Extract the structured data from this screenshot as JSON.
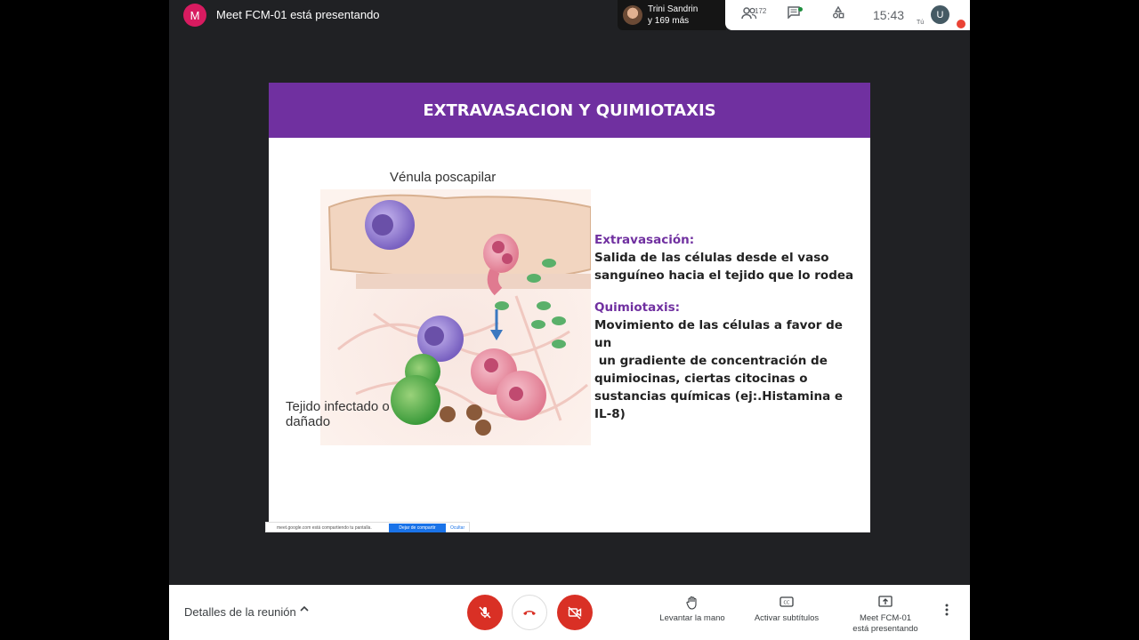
{
  "topbar": {
    "presenter_initial": "M",
    "presenting_title": "Meet FCM-01 está presentando",
    "participants_chip": {
      "line1": "Trini Sandrin",
      "line2": "y 169 más"
    },
    "participants_count": "172",
    "clock": "15:43",
    "user_initial": "U",
    "you_label": "Tú"
  },
  "slide": {
    "title": "EXTRAVASACION Y QUIMIOTAXIS",
    "figure_labels": {
      "venule": "Vénula poscapilar",
      "tissue": "Tejido infectado o dañado"
    },
    "extravasation": {
      "heading": "Extravasación:",
      "text": "Salida de las células desde el vaso sanguíneo hacia el tejido que lo rodea"
    },
    "chemotaxis": {
      "heading": "Quimiotaxis:",
      "line1": "Movimiento de las células a favor de un",
      "line2": " un gradiente de concentración de",
      "line3": "quimiocinas, ciertas citocinas o",
      "line4": "sustancias químicas (ej:.Histamina e IL-8)"
    }
  },
  "share_banner": {
    "text": "meet.google.com está compartiendo tu pantalla.",
    "stop": "Dejar de compartir",
    "hide": "Ocultar"
  },
  "bottombar": {
    "details": "Detalles de la reunión",
    "raise_hand": "Levantar la mano",
    "captions": "Activar subtítulos",
    "presenting_line1": "Meet FCM-01",
    "presenting_line2": "está presentando"
  },
  "colors": {
    "header": "#7030a0",
    "accent_red": "#d93025"
  },
  "icons": [
    "people-icon",
    "chat-icon",
    "activities-icon",
    "mic-off-icon",
    "hangup-icon",
    "camera-off-icon",
    "hand-icon",
    "captions-icon",
    "present-icon",
    "more-icon"
  ]
}
